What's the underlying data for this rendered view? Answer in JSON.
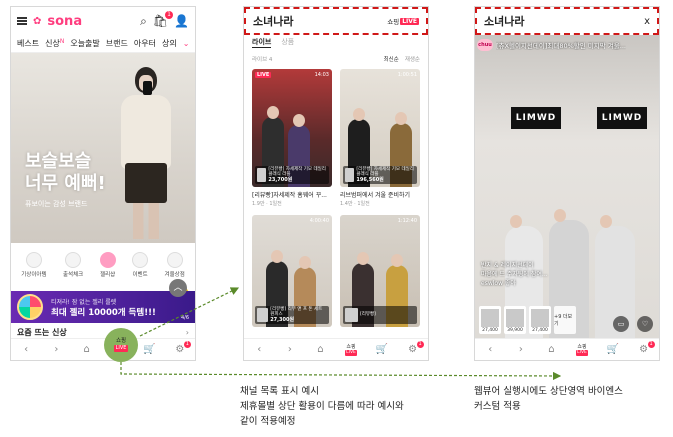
{
  "phone1": {
    "logo": "sona",
    "cart_count": "1",
    "categories": [
      "베스트",
      "신상",
      "오늘출발",
      "브랜드",
      "아우터",
      "상의"
    ],
    "new_mark": "N",
    "hero": {
      "title_line1": "보슬보슬",
      "title_line2": "너무 예뻐!",
      "subtitle": "퓨보이는 감성 브랜드"
    },
    "quick_icons": [
      {
        "label": "기상이아템",
        "icon": "thermometer-icon"
      },
      {
        "label": "출석체크",
        "icon": "check-icon"
      },
      {
        "label": "젤리샵",
        "icon": "heart-icon"
      },
      {
        "label": "이벤트",
        "icon": "gift-icon"
      },
      {
        "label": "겨울상점",
        "icon": "snowflake-icon"
      }
    ],
    "banner": {
      "small": "티져라! 잠 없는 젤리 룰렛",
      "big": "최대 젤리 10000개 득템!!!",
      "page": "4/6"
    },
    "section_title": "요즘 뜨는 신상",
    "shopping_label": "쇼핑",
    "live_label": "LIVE",
    "notif_count": "1"
  },
  "phone2": {
    "channel_title": "소녀나라",
    "shopping_label": "쇼핑",
    "live_label": "LIVE",
    "tabs": [
      "라이브",
      "상품"
    ],
    "count_label": "라이브 4",
    "sort": [
      "최신순",
      "재생순"
    ],
    "cards": [
      {
        "badge": "LIVE",
        "duration": "14:03",
        "prod_name": "[리뷰빵] 자세제작 기모 데일리 클래식 라플",
        "price": "23,700원",
        "title": "[리뷰빵]자세제작 홈웨어 꾸...",
        "meta": "1.9만 · 1일전"
      },
      {
        "badge": "",
        "duration": "1:00:51",
        "prod_name": "[리뷰빵] 자세제작 기모 데일리 클래식 라플",
        "price": "196,560원",
        "title": "리브범퍼에서 겨울 준비하기",
        "meta": "1.4만 · 1일전"
      },
      {
        "badge": "",
        "duration": "4:00:40",
        "prod_name": "[리뷰빵] 리부 앤 프 돈 세트 원피스",
        "price": "27,300원",
        "title": "",
        "meta": ""
      },
      {
        "badge": "",
        "duration": "1:12:40",
        "prod_name": "[리뷰빵]",
        "price": "",
        "title": "",
        "meta": ""
      }
    ]
  },
  "phone3": {
    "channel_title": "소녀나라",
    "close_label": "x",
    "channel_badge": "chuu",
    "stream_title": "[츄X헬이지선데이]최대80%할인 미지막 겨울...",
    "sign_text": "LIMWD",
    "caption_line1": "반지 & 레이지선데이",
    "caption_line2": "마음에 드 주자팅에 참여...",
    "caption_line3": "eswlow 좋아",
    "products": [
      "27,400",
      "39,900",
      "27,400"
    ],
    "more_label": "+9 더보기"
  },
  "captions": {
    "left_line1": "채널 목록 표시 예시",
    "left_line2": "제휴몰별 상단 활용이 다름에 따라 예시와",
    "left_line3": "같이 적용예정",
    "right_line1": "웹뷰어 실행시에도 상단영역 바이엔스",
    "right_line2": "커스텀 적용"
  },
  "colors": {
    "brand_pink": "#ff3d7f",
    "live_red": "#ff2a55",
    "dash_red": "#d01818",
    "arrow_green": "#5a8a2a"
  }
}
